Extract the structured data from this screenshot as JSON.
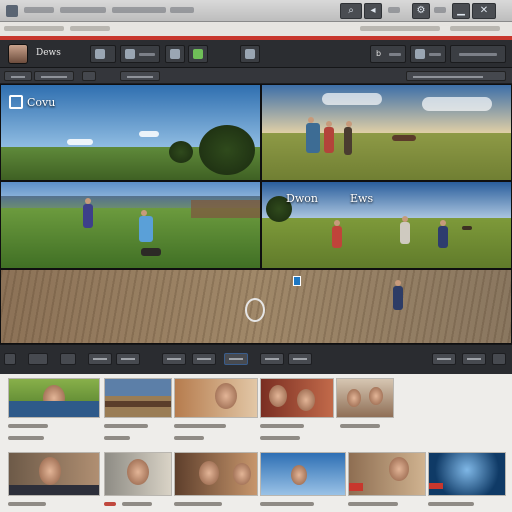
{
  "app": {
    "title": "Dews",
    "toolbar_label": "b"
  },
  "viewer": {
    "tile_labels": {
      "top_left": "Covu",
      "mid_right_left": "Dwon",
      "mid_right_right": "Ews"
    }
  },
  "colors": {
    "accent": "#c8372d",
    "toolbar": "#2b2d31",
    "browser_bg": "#eeedea"
  },
  "icons": [
    "window-icon",
    "search-icon",
    "settings-icon",
    "close-icon",
    "play-icon",
    "marker-icon",
    "avatar"
  ]
}
